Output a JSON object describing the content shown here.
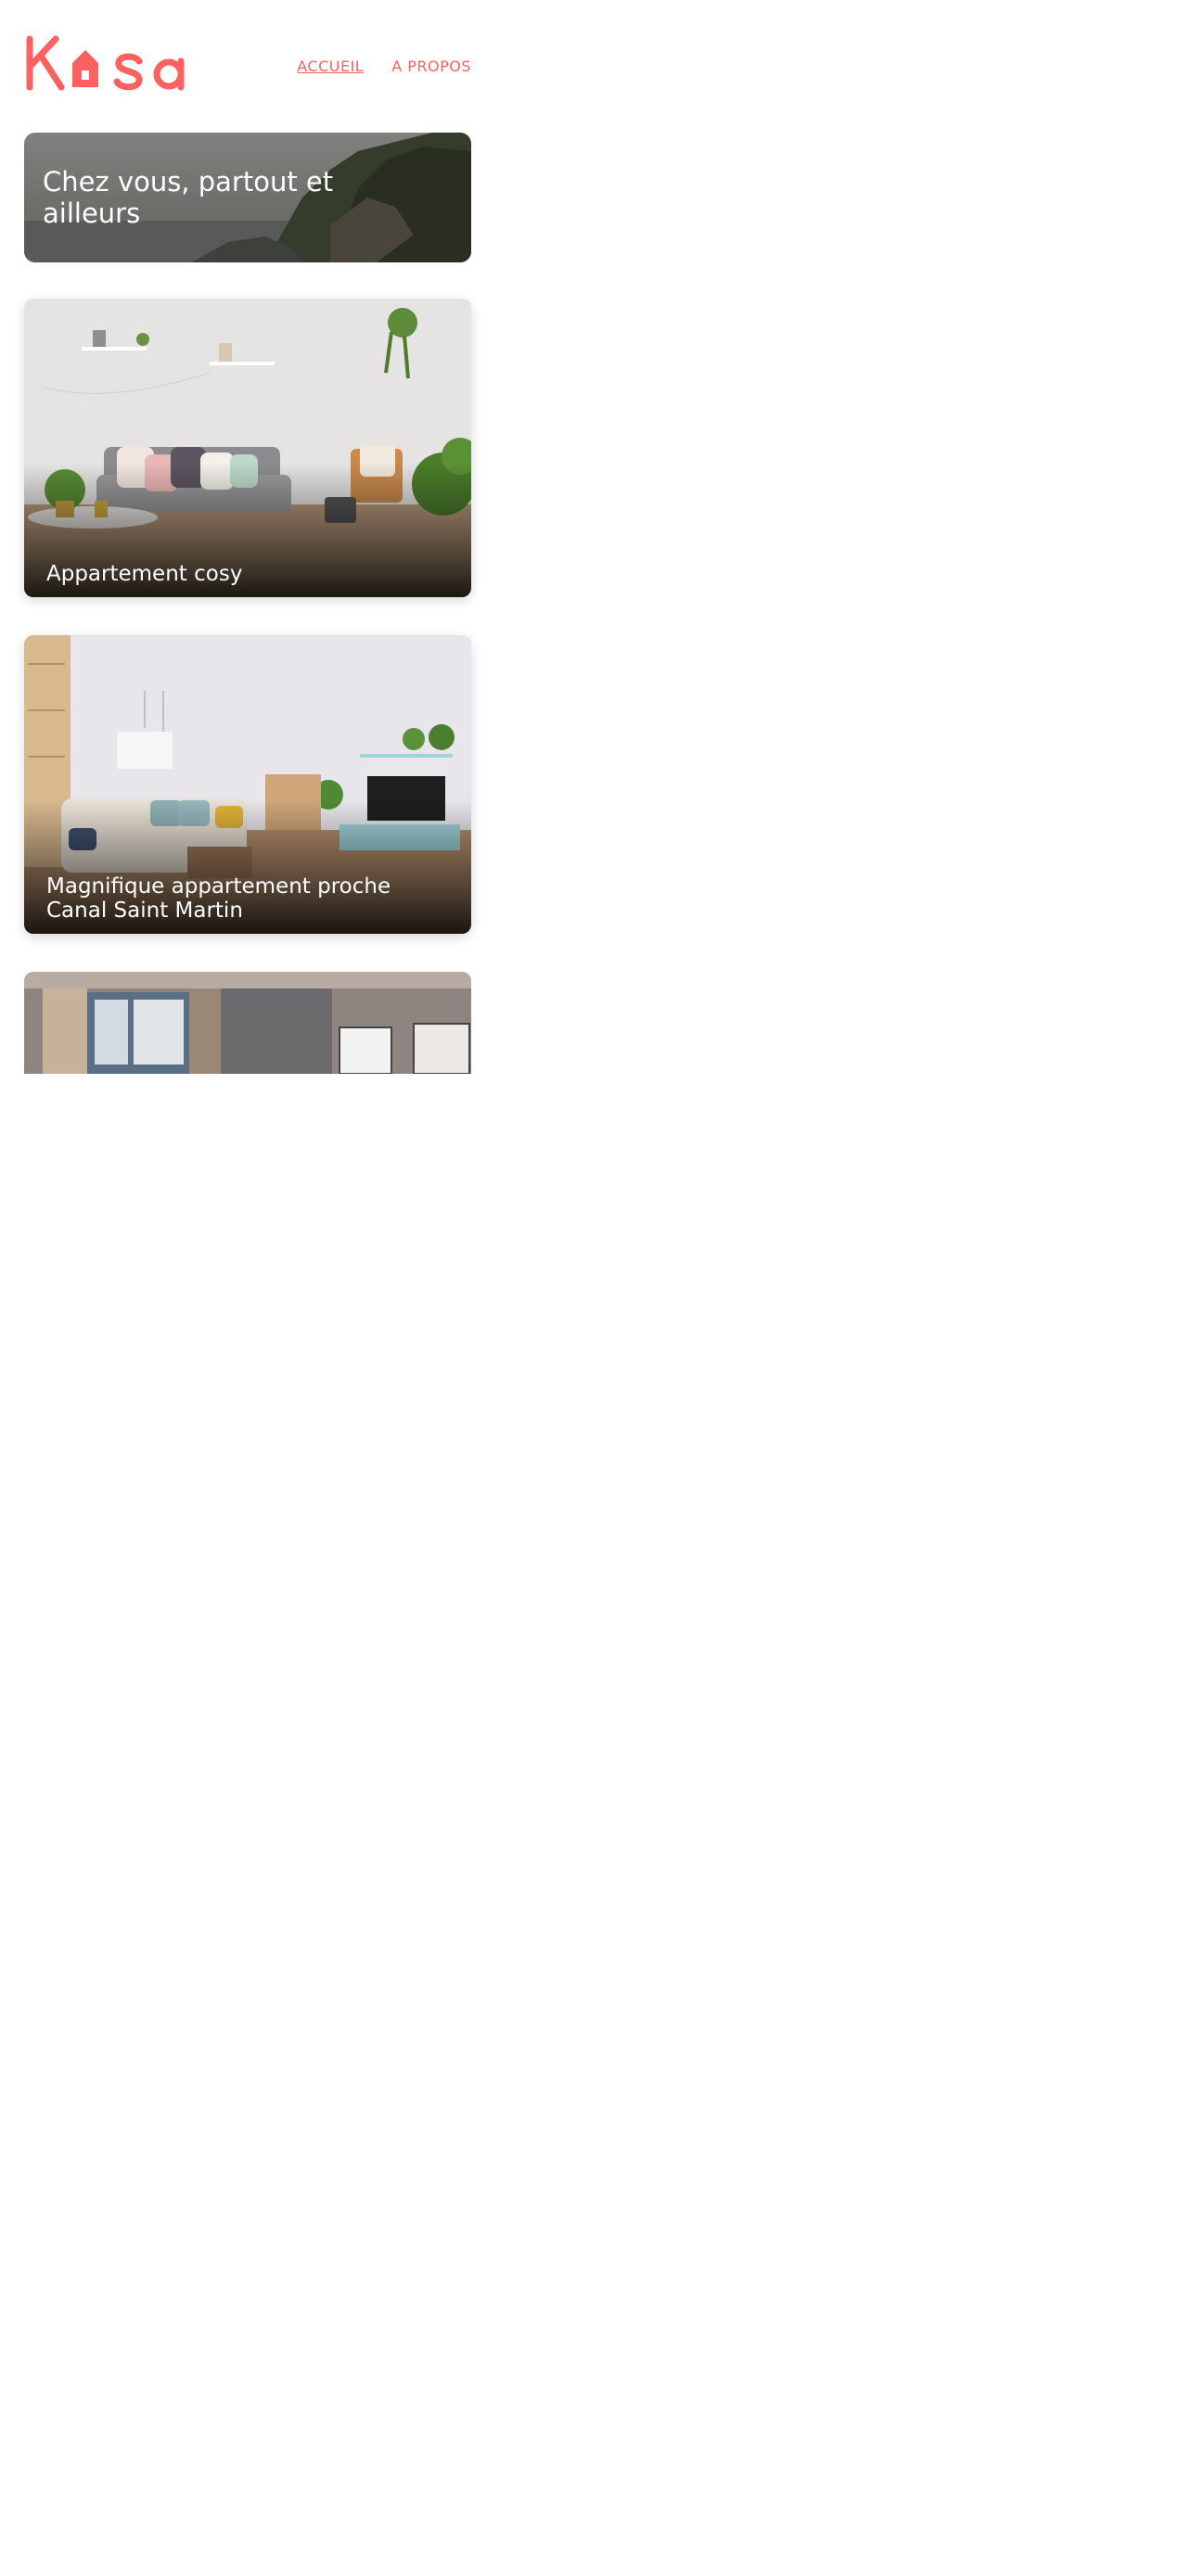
{
  "header": {
    "logo_text": "Kasa",
    "brand_color": "#FF6060",
    "nav": [
      {
        "label": "ACCUEIL",
        "active": true
      },
      {
        "label": "A PROPOS",
        "active": false
      }
    ]
  },
  "banner": {
    "title": "Chez vous, partout et ailleurs"
  },
  "cards": [
    {
      "title": "Appartement cosy"
    },
    {
      "title": "Magnifique appartement proche Canal Saint Martin"
    },
    {
      "title": ""
    }
  ]
}
